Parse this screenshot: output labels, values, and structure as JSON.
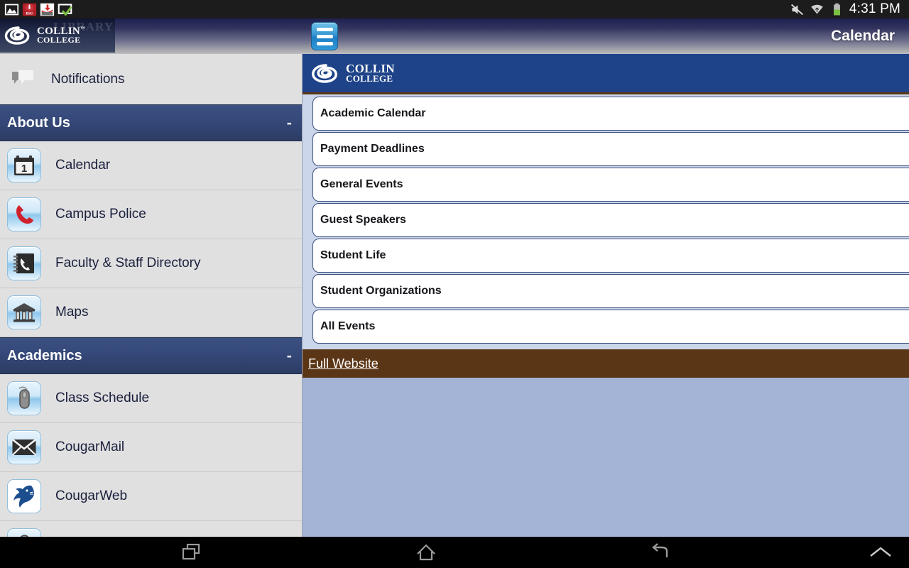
{
  "status_bar": {
    "time": "4:31 PM",
    "left_icons": [
      {
        "name": "gallery-image-icon",
        "label": "Image"
      },
      {
        "name": "bsu-app-icon",
        "label": "BSU"
      },
      {
        "name": "download-arrow-icon",
        "label": "Download"
      },
      {
        "name": "screen-check-icon",
        "label": "Screen Ready"
      }
    ],
    "right_icons": [
      {
        "name": "mute-icon",
        "label": "Sound Muted"
      },
      {
        "name": "wifi-icon",
        "label": "Wi-Fi"
      },
      {
        "name": "battery-icon",
        "label": "Battery"
      }
    ]
  },
  "app_bar": {
    "title": "Calendar",
    "menu_button_label": "Menu",
    "banner_ghost_text": "LIBRARY",
    "brand_line1": "COLLIN",
    "brand_line2": "COLLEGE",
    "trademark": "™"
  },
  "sidebar": {
    "notifications": {
      "label": "Notifications",
      "icon": "speech-bubble-icon"
    },
    "sections": [
      {
        "title": "About Us",
        "toggle": "-",
        "items": [
          {
            "label": "Calendar",
            "icon": "calendar-icon"
          },
          {
            "label": "Campus Police",
            "icon": "phone-receiver-icon"
          },
          {
            "label": "Faculty & Staff Directory",
            "icon": "phone-book-icon"
          },
          {
            "label": "Maps",
            "icon": "bank-building-icon"
          }
        ]
      },
      {
        "title": "Academics",
        "toggle": "-",
        "items": [
          {
            "label": "Class Schedule",
            "icon": "computer-mouse-icon"
          },
          {
            "label": "CougarMail",
            "icon": "envelope-icon"
          },
          {
            "label": "CougarWeb",
            "icon": "cougar-mascot-icon"
          },
          {
            "label": "",
            "icon": "computer-mouse-icon"
          }
        ]
      }
    ]
  },
  "content": {
    "brand_line1": "COLLIN",
    "brand_line2": "COLLEGE",
    "list_items": [
      {
        "label": "Academic Calendar"
      },
      {
        "label": "Payment Deadlines"
      },
      {
        "label": "General Events"
      },
      {
        "label": "Guest Speakers"
      },
      {
        "label": "Student Life"
      },
      {
        "label": "Student Organizations"
      },
      {
        "label": "All Events"
      }
    ],
    "full_website_link": "Full Website"
  },
  "nav_bar": {
    "buttons": [
      {
        "name": "recents-icon",
        "label": "Recent Apps"
      },
      {
        "name": "home-icon",
        "label": "Home"
      },
      {
        "name": "back-icon",
        "label": "Back"
      },
      {
        "name": "chevron-up-icon",
        "label": "Expand"
      }
    ]
  },
  "colors": {
    "brand_blue": "#1e4388",
    "brand_brown": "#5b3616",
    "section_header": "#2c3c64",
    "content_bg": "#a4b4d6",
    "list_bg": "#ccd6ea"
  }
}
